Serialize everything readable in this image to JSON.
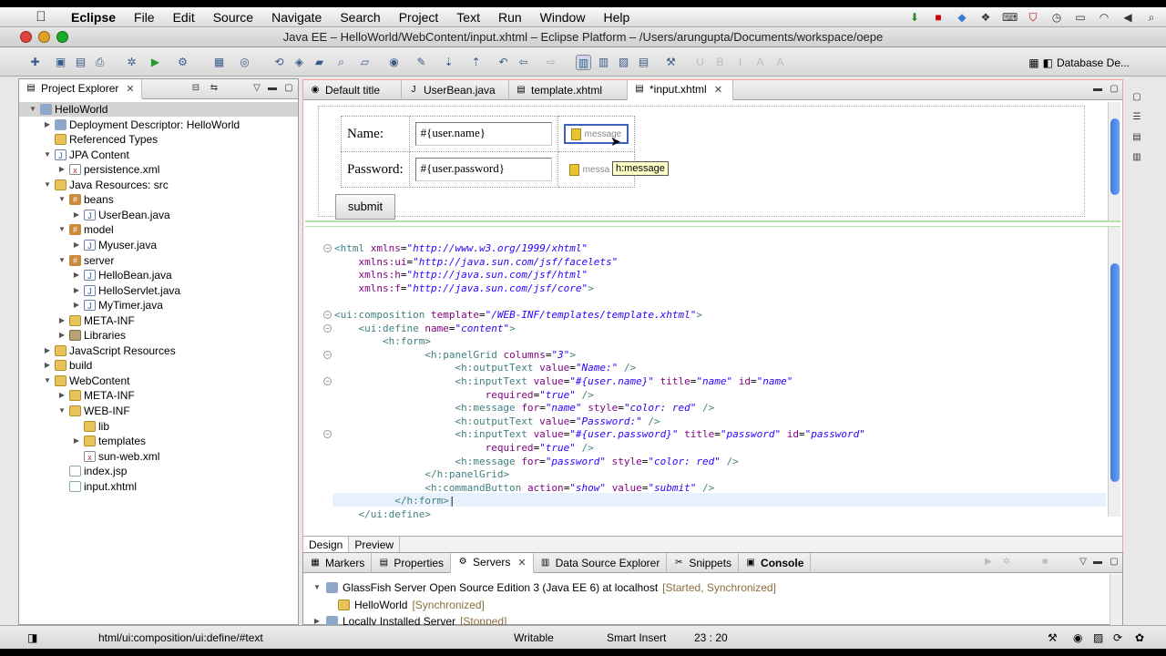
{
  "menubar": {
    "app": "Eclipse",
    "items": [
      "File",
      "Edit",
      "Source",
      "Navigate",
      "Search",
      "Project",
      "Text",
      "Run",
      "Window",
      "Help"
    ]
  },
  "window": {
    "title": "Java EE – HelloWorld/WebContent/input.xhtml – Eclipse Platform – /Users/arungupta/Documents/workspace/oepe"
  },
  "toolbar": {
    "perspective": "Database De..."
  },
  "explorer": {
    "tab": "Project Explorer",
    "tree": [
      {
        "label": "HelloWorld",
        "depth": 0,
        "tw": "▼",
        "icon": "project-icon",
        "sel": true
      },
      {
        "label": "Deployment Descriptor: HelloWorld",
        "depth": 1,
        "tw": "▶",
        "icon": "descriptor-icon"
      },
      {
        "label": "Referenced Types",
        "depth": 1,
        "tw": "",
        "icon": "folder-icon"
      },
      {
        "label": "JPA Content",
        "depth": 1,
        "tw": "▼",
        "icon": "jpa-icon"
      },
      {
        "label": "persistence.xml",
        "depth": 2,
        "tw": "▶",
        "icon": "xml-file-icon"
      },
      {
        "label": "Java Resources: src",
        "depth": 1,
        "tw": "▼",
        "icon": "java-resources-icon"
      },
      {
        "label": "beans",
        "depth": 2,
        "tw": "▼",
        "icon": "package-icon"
      },
      {
        "label": "UserBean.java",
        "depth": 3,
        "tw": "▶",
        "icon": "java-file-icon"
      },
      {
        "label": "model",
        "depth": 2,
        "tw": "▼",
        "icon": "package-icon"
      },
      {
        "label": "Myuser.java",
        "depth": 3,
        "tw": "▶",
        "icon": "java-file-icon"
      },
      {
        "label": "server",
        "depth": 2,
        "tw": "▼",
        "icon": "package-icon"
      },
      {
        "label": "HelloBean.java",
        "depth": 3,
        "tw": "▶",
        "icon": "java-file-icon"
      },
      {
        "label": "HelloServlet.java",
        "depth": 3,
        "tw": "▶",
        "icon": "java-file-icon"
      },
      {
        "label": "MyTimer.java",
        "depth": 3,
        "tw": "▶",
        "icon": "java-file-icon"
      },
      {
        "label": "META-INF",
        "depth": 2,
        "tw": "▶",
        "icon": "folder-icon"
      },
      {
        "label": "Libraries",
        "depth": 2,
        "tw": "▶",
        "icon": "library-icon"
      },
      {
        "label": "JavaScript Resources",
        "depth": 1,
        "tw": "▶",
        "icon": "javascript-icon"
      },
      {
        "label": "build",
        "depth": 1,
        "tw": "▶",
        "icon": "folder-icon"
      },
      {
        "label": "WebContent",
        "depth": 1,
        "tw": "▼",
        "icon": "folder-icon"
      },
      {
        "label": "META-INF",
        "depth": 2,
        "tw": "▶",
        "icon": "folder-icon"
      },
      {
        "label": "WEB-INF",
        "depth": 2,
        "tw": "▼",
        "icon": "folder-icon"
      },
      {
        "label": "lib",
        "depth": 3,
        "tw": "",
        "icon": "folder-icon"
      },
      {
        "label": "templates",
        "depth": 3,
        "tw": "▶",
        "icon": "folder-icon"
      },
      {
        "label": "sun-web.xml",
        "depth": 3,
        "tw": "",
        "icon": "xml-file-icon"
      },
      {
        "label": "index.jsp",
        "depth": 2,
        "tw": "",
        "icon": "jsp-file-icon"
      },
      {
        "label": "input.xhtml",
        "depth": 2,
        "tw": "",
        "icon": "xhtml-file-icon"
      }
    ]
  },
  "editor": {
    "tabs": [
      {
        "label": "Default title",
        "icon": "web-icon"
      },
      {
        "label": "UserBean.java",
        "icon": "java-file-icon"
      },
      {
        "label": "template.xhtml",
        "icon": "xhtml-file-icon"
      },
      {
        "label": "*input.xhtml",
        "icon": "xhtml-file-icon",
        "active": true
      }
    ],
    "design": {
      "name_label": "Name:",
      "name_value": "#{user.name}",
      "password_label": "Password:",
      "password_value": "#{user.password}",
      "message_placeholder": "message",
      "message_partial": "messa",
      "tooltip": "h:message",
      "submit": "submit"
    },
    "code": [
      {
        "f": "⊖",
        "h": "<span class=\"tg\">&lt;html</span> <span class=\"at\">xmlns</span>=<span class=\"st\">\"http://www.w3.org/1999/xhtml\"</span>"
      },
      {
        "f": "",
        "h": "    <span class=\"at\">xmlns:ui</span>=<span class=\"st\">\"http://java.sun.com/jsf/facelets\"</span>"
      },
      {
        "f": "",
        "h": "    <span class=\"at\">xmlns:h</span>=<span class=\"st\">\"http://java.sun.com/jsf/html\"</span>"
      },
      {
        "f": "",
        "h": "    <span class=\"at\">xmlns:f</span>=<span class=\"st\">\"http://java.sun.com/jsf/core\"</span><span class=\"tg\">&gt;</span>"
      },
      {
        "f": "",
        "h": ""
      },
      {
        "f": "⊖",
        "h": "<span class=\"tg\">&lt;ui:composition</span> <span class=\"at\">template</span>=<span class=\"st\">\"/WEB-INF/templates/template.xhtml\"</span><span class=\"tg\">&gt;</span>"
      },
      {
        "f": "⊖",
        "h": "    <span class=\"tg\">&lt;ui:define</span> <span class=\"at\">name</span>=<span class=\"st\">\"content\"</span><span class=\"tg\">&gt;</span>"
      },
      {
        "f": "",
        "h": "        <span class=\"tg\">&lt;h:form&gt;</span>"
      },
      {
        "f": "⊖",
        "h": "               <span class=\"tg\">&lt;h:panelGrid</span> <span class=\"at\">columns</span>=<span class=\"st\">\"3\"</span><span class=\"tg\">&gt;</span>"
      },
      {
        "f": "",
        "h": "                    <span class=\"tg\">&lt;h:outputText</span> <span class=\"at\">value</span>=<span class=\"st\">\"Name:\"</span> <span class=\"tg\">/&gt;</span>"
      },
      {
        "f": "⊖",
        "h": "                    <span class=\"tg\">&lt;h:inputText</span> <span class=\"at\">value</span>=<span class=\"st\">\"#{user.name}\"</span> <span class=\"at\">title</span>=<span class=\"st\">\"name\"</span> <span class=\"at\">id</span>=<span class=\"st\">\"name\"</span>"
      },
      {
        "f": "",
        "h": "                         <span class=\"at\">required</span>=<span class=\"st\">\"true\"</span> <span class=\"tg\">/&gt;</span>"
      },
      {
        "f": "",
        "h": "                    <span class=\"tg\">&lt;h:message</span> <span class=\"at\">for</span>=<span class=\"st\">\"name\"</span> <span class=\"at\">style</span>=<span class=\"st\">\"color: red\"</span> <span class=\"tg\">/&gt;</span>"
      },
      {
        "f": "",
        "h": "                    <span class=\"tg\">&lt;h:outputText</span> <span class=\"at\">value</span>=<span class=\"st\">\"Password:\"</span> <span class=\"tg\">/&gt;</span>"
      },
      {
        "f": "⊖",
        "h": "                    <span class=\"tg\">&lt;h:inputText</span> <span class=\"at\">value</span>=<span class=\"st\">\"#{user.password}\"</span> <span class=\"at\">title</span>=<span class=\"st\">\"password\"</span> <span class=\"at\">id</span>=<span class=\"st\">\"password\"</span>"
      },
      {
        "f": "",
        "h": "                         <span class=\"at\">required</span>=<span class=\"st\">\"true\"</span> <span class=\"tg\">/&gt;</span>"
      },
      {
        "f": "",
        "h": "                    <span class=\"tg\">&lt;h:message</span> <span class=\"at\">for</span>=<span class=\"st\">\"password\"</span> <span class=\"at\">style</span>=<span class=\"st\">\"color: red\"</span> <span class=\"tg\">/&gt;</span>"
      },
      {
        "f": "",
        "h": "               <span class=\"tg\">&lt;/h:panelGrid&gt;</span>"
      },
      {
        "f": "",
        "h": "               <span class=\"tg\">&lt;h:commandButton</span> <span class=\"at\">action</span>=<span class=\"st\">\"show\"</span> <span class=\"at\">value</span>=<span class=\"st\">\"submit\"</span> <span class=\"tg\">/&gt;</span>"
      },
      {
        "f": "",
        "h": "          <span class=\"tg\">&lt;/h:form&gt;</span>|",
        "cur": true
      },
      {
        "f": "",
        "h": "    <span class=\"tg\">&lt;/ui:define&gt;</span>"
      }
    ],
    "design_tab": "Design",
    "preview_tab": "Preview"
  },
  "bottom": {
    "tabs": [
      {
        "label": "Markers",
        "icon": "markers-icon"
      },
      {
        "label": "Properties",
        "icon": "properties-icon"
      },
      {
        "label": "Servers",
        "icon": "servers-icon",
        "active": true
      },
      {
        "label": "Data Source Explorer",
        "icon": "datasource-icon"
      },
      {
        "label": "Snippets",
        "icon": "snippets-icon"
      },
      {
        "label": "Console",
        "icon": "console-icon"
      }
    ],
    "servers": [
      {
        "name": "GlassFish Server Open Source Edition 3 (Java EE 6) at localhost",
        "state": "[Started, Synchronized]",
        "depth": 0
      },
      {
        "name": "HelloWorld",
        "state": "[Synchronized]",
        "depth": 1
      },
      {
        "name": "Locally Installed Server",
        "state": "[Stopped]",
        "depth": 0
      }
    ]
  },
  "status": {
    "path": "html/ui:composition/ui:define/#text",
    "mode": "Writable",
    "insert": "Smart Insert",
    "position": "23 : 20"
  }
}
